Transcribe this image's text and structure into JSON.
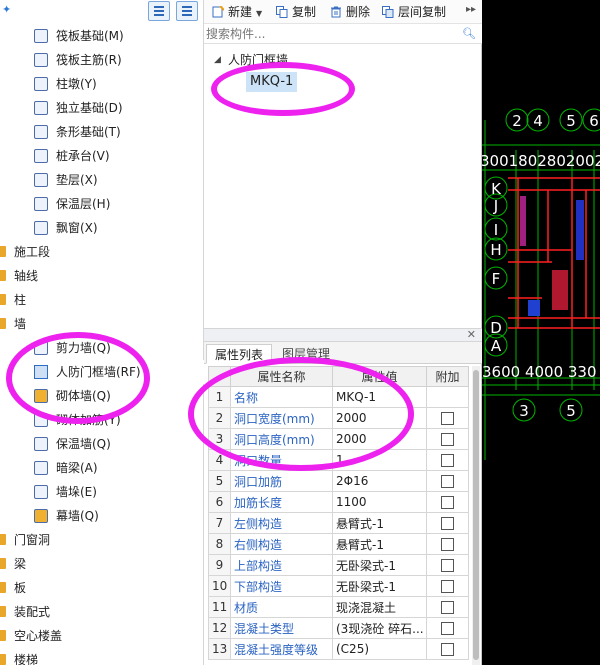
{
  "left_tree": {
    "items": [
      {
        "label": "筏板基础(M)",
        "level": 2,
        "icon": "raft-foundation-icon"
      },
      {
        "label": "筏板主筋(R)",
        "level": 2,
        "icon": "raft-rebar-icon"
      },
      {
        "label": "柱墩(Y)",
        "level": 2,
        "icon": "column-pier-icon"
      },
      {
        "label": "独立基础(D)",
        "level": 2,
        "icon": "isolated-footing-icon"
      },
      {
        "label": "条形基础(T)",
        "level": 2,
        "icon": "strip-footing-icon"
      },
      {
        "label": "桩承台(V)",
        "level": 2,
        "icon": "pile-cap-icon"
      },
      {
        "label": "垫层(X)",
        "level": 2,
        "icon": "cushion-icon"
      },
      {
        "label": "保温层(H)",
        "level": 2,
        "icon": "insulation-icon"
      },
      {
        "label": "飘窗(X)",
        "level": 2,
        "icon": "bay-window-icon"
      },
      {
        "label": "施工段",
        "level": 1,
        "icon": "folder-icon"
      },
      {
        "label": "轴线",
        "level": 1,
        "icon": "folder-icon"
      },
      {
        "label": "柱",
        "level": 1,
        "icon": "folder-icon"
      },
      {
        "label": "墙",
        "level": 1,
        "icon": "folder-icon"
      },
      {
        "label": "剪力墙(Q)",
        "level": 2,
        "icon": "shear-wall-icon"
      },
      {
        "label": "人防门框墙(RF)",
        "level": 2,
        "icon": "civil-defense-door-icon",
        "selected": true
      },
      {
        "label": "砌体墙(Q)",
        "level": 2,
        "icon": "masonry-wall-icon"
      },
      {
        "label": "砌体加筋(Y)",
        "level": 2,
        "icon": "masonry-rebar-icon"
      },
      {
        "label": "保温墙(Q)",
        "level": 2,
        "icon": "insulation-wall-icon"
      },
      {
        "label": "暗梁(A)",
        "level": 2,
        "icon": "hidden-beam-icon"
      },
      {
        "label": "墙垛(E)",
        "level": 2,
        "icon": "wall-buttress-icon"
      },
      {
        "label": "幕墙(Q)",
        "level": 2,
        "icon": "curtain-wall-icon"
      },
      {
        "label": "门窗洞",
        "level": 1,
        "icon": "folder-icon"
      },
      {
        "label": "梁",
        "level": 1,
        "icon": "folder-icon"
      },
      {
        "label": "板",
        "level": 1,
        "icon": "folder-icon"
      },
      {
        "label": "装配式",
        "level": 1,
        "icon": "folder-icon"
      },
      {
        "label": "空心楼盖",
        "level": 1,
        "icon": "folder-icon"
      },
      {
        "label": "楼梯",
        "level": 1,
        "icon": "folder-icon"
      }
    ]
  },
  "toolbar": {
    "new_label": "新建",
    "copy_label": "复制",
    "delete_label": "删除",
    "floor_copy_label": "层间复制"
  },
  "search": {
    "placeholder": "搜索构件..."
  },
  "component_tree": {
    "group": "人防门框墙",
    "item": "MKQ-1"
  },
  "props": {
    "tabs": [
      "属性列表",
      "图层管理"
    ],
    "columns": [
      "属性名称",
      "属性值",
      "附加"
    ],
    "rows": [
      {
        "idx": "1",
        "name": "名称",
        "value": "MKQ-1"
      },
      {
        "idx": "2",
        "name": "洞口宽度(mm)",
        "value": "2000"
      },
      {
        "idx": "3",
        "name": "洞口高度(mm)",
        "value": "2000"
      },
      {
        "idx": "4",
        "name": "洞口数量",
        "value": "1"
      },
      {
        "idx": "5",
        "name": "洞口加筋",
        "value": "2Φ16"
      },
      {
        "idx": "6",
        "name": "加筋长度",
        "value": "1100"
      },
      {
        "idx": "7",
        "name": "左侧构造",
        "value": "悬臂式-1"
      },
      {
        "idx": "8",
        "name": "右侧构造",
        "value": "悬臂式-1"
      },
      {
        "idx": "9",
        "name": "上部构造",
        "value": "无卧梁式-1"
      },
      {
        "idx": "10",
        "name": "下部构造",
        "value": "无卧梁式-1"
      },
      {
        "idx": "11",
        "name": "材质",
        "value": "现浇混凝土"
      },
      {
        "idx": "12",
        "name": "混凝土类型",
        "value": "(3现浇砼 碎石..."
      },
      {
        "idx": "13",
        "name": "混凝土强度等级",
        "value": "(C25)"
      }
    ]
  },
  "cad": {
    "top_axis_labels": [
      "2",
      "4",
      "5",
      "6"
    ],
    "top_dims": "3001802802002",
    "side_axis_labels": [
      "K",
      "J",
      "I",
      "H",
      "F",
      "D",
      "A"
    ],
    "bottom_dims": "3600 4000 330",
    "bottom_axis_labels": [
      "3",
      "5"
    ],
    "colors": {
      "grid": "#00cc00",
      "wall": "#ff2020",
      "text": "#ffffff",
      "highlight": "#ee22ee"
    }
  }
}
